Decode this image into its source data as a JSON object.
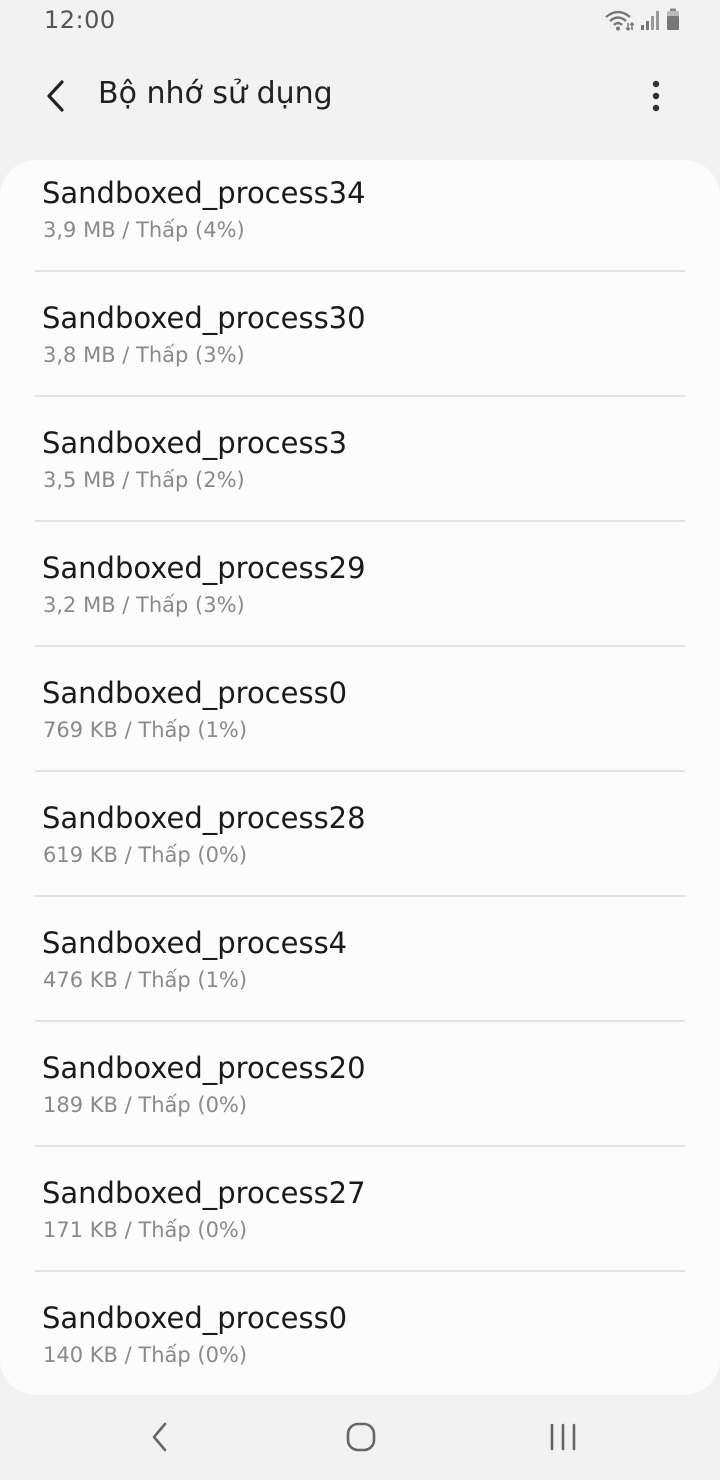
{
  "status_bar": {
    "time": "12:00"
  },
  "header": {
    "title": "Bộ nhớ sử dụng",
    "back_icon": "back-arrow-icon",
    "more_icon": "more-vertical-icon"
  },
  "processes": [
    {
      "name": "Sandboxed_process34",
      "detail": "3,9 MB / Thấp (4%)"
    },
    {
      "name": "Sandboxed_process30",
      "detail": "3,8 MB / Thấp (3%)"
    },
    {
      "name": "Sandboxed_process3",
      "detail": "3,5 MB / Thấp (2%)"
    },
    {
      "name": "Sandboxed_process29",
      "detail": "3,2 MB / Thấp (3%)"
    },
    {
      "name": "Sandboxed_process0",
      "detail": "769 KB / Thấp (1%)"
    },
    {
      "name": "Sandboxed_process28",
      "detail": "619 KB / Thấp (0%)"
    },
    {
      "name": "Sandboxed_process4",
      "detail": "476 KB / Thấp (1%)"
    },
    {
      "name": "Sandboxed_process20",
      "detail": "189 KB / Thấp (0%)"
    },
    {
      "name": "Sandboxed_process27",
      "detail": "171 KB / Thấp (0%)"
    },
    {
      "name": "Sandboxed_process0",
      "detail": "140 KB / Thấp (0%)"
    }
  ],
  "nav_bar": {
    "back_icon": "nav-back-icon",
    "home_icon": "nav-home-icon",
    "recents_icon": "nav-recents-icon"
  },
  "colors": {
    "background": "#f2f2f2",
    "card": "#fcfcfc",
    "primary_text": "#1a1a1a",
    "secondary_text": "#8a8a8a",
    "divider": "#e3e3e3"
  }
}
